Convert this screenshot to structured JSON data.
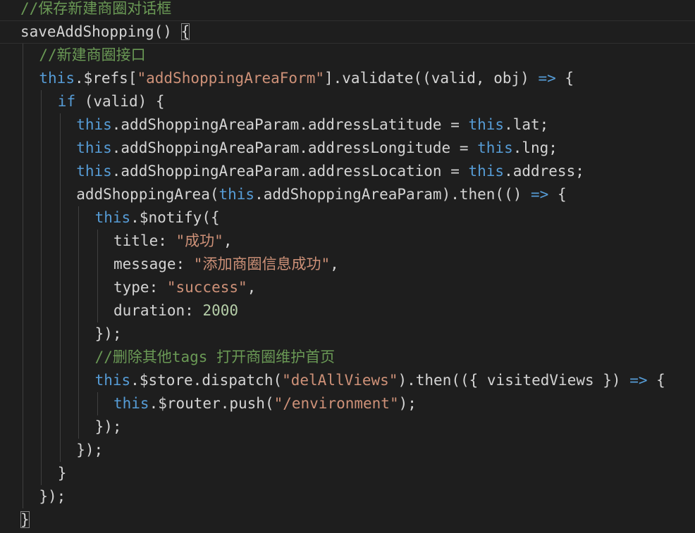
{
  "editor": {
    "lines": [
      {
        "indent": 0,
        "guides": 0,
        "tokens": [
          {
            "t": "comment",
            "v": "//保存新建商圈对话框"
          }
        ]
      },
      {
        "indent": 0,
        "guides": 0,
        "current": true,
        "tokens": [
          {
            "t": "plain",
            "v": "saveAddShopping() "
          },
          {
            "t": "plain",
            "v": "{",
            "match": true
          }
        ]
      },
      {
        "indent": 1,
        "guides": 1,
        "tokens": [
          {
            "t": "comment",
            "v": "//新建商圈接口"
          }
        ]
      },
      {
        "indent": 1,
        "guides": 1,
        "tokens": [
          {
            "t": "keyword",
            "v": "this"
          },
          {
            "t": "plain",
            "v": ".$refs["
          },
          {
            "t": "string",
            "v": "\"addShoppingAreaForm\""
          },
          {
            "t": "plain",
            "v": "].validate((valid, obj) "
          },
          {
            "t": "keyword",
            "v": "=>"
          },
          {
            "t": "plain",
            "v": " {"
          }
        ]
      },
      {
        "indent": 2,
        "guides": 2,
        "tokens": [
          {
            "t": "control",
            "v": "if"
          },
          {
            "t": "plain",
            "v": " (valid) {"
          }
        ]
      },
      {
        "indent": 3,
        "guides": 3,
        "tokens": [
          {
            "t": "keyword",
            "v": "this"
          },
          {
            "t": "plain",
            "v": ".addShoppingAreaParam.addressLatitude = "
          },
          {
            "t": "keyword",
            "v": "this"
          },
          {
            "t": "plain",
            "v": ".lat;"
          }
        ]
      },
      {
        "indent": 3,
        "guides": 3,
        "tokens": [
          {
            "t": "keyword",
            "v": "this"
          },
          {
            "t": "plain",
            "v": ".addShoppingAreaParam.addressLongitude = "
          },
          {
            "t": "keyword",
            "v": "this"
          },
          {
            "t": "plain",
            "v": ".lng;"
          }
        ]
      },
      {
        "indent": 3,
        "guides": 3,
        "tokens": [
          {
            "t": "keyword",
            "v": "this"
          },
          {
            "t": "plain",
            "v": ".addShoppingAreaParam.addressLocation = "
          },
          {
            "t": "keyword",
            "v": "this"
          },
          {
            "t": "plain",
            "v": ".address;"
          }
        ]
      },
      {
        "indent": 3,
        "guides": 3,
        "tokens": [
          {
            "t": "plain",
            "v": "addShoppingArea("
          },
          {
            "t": "keyword",
            "v": "this"
          },
          {
            "t": "plain",
            "v": ".addShoppingAreaParam).then(() "
          },
          {
            "t": "keyword",
            "v": "=>"
          },
          {
            "t": "plain",
            "v": " {"
          }
        ]
      },
      {
        "indent": 4,
        "guides": 4,
        "tokens": [
          {
            "t": "keyword",
            "v": "this"
          },
          {
            "t": "plain",
            "v": ".$notify({"
          }
        ]
      },
      {
        "indent": 5,
        "guides": 5,
        "tokens": [
          {
            "t": "plain",
            "v": "title: "
          },
          {
            "t": "string",
            "v": "\"成功\""
          },
          {
            "t": "plain",
            "v": ","
          }
        ]
      },
      {
        "indent": 5,
        "guides": 5,
        "tokens": [
          {
            "t": "plain",
            "v": "message: "
          },
          {
            "t": "string",
            "v": "\"添加商圈信息成功\""
          },
          {
            "t": "plain",
            "v": ","
          }
        ]
      },
      {
        "indent": 5,
        "guides": 5,
        "tokens": [
          {
            "t": "plain",
            "v": "type: "
          },
          {
            "t": "string",
            "v": "\"success\""
          },
          {
            "t": "plain",
            "v": ","
          }
        ]
      },
      {
        "indent": 5,
        "guides": 5,
        "tokens": [
          {
            "t": "plain",
            "v": "duration: "
          },
          {
            "t": "number",
            "v": "2000"
          }
        ]
      },
      {
        "indent": 4,
        "guides": 4,
        "tokens": [
          {
            "t": "plain",
            "v": "});"
          }
        ]
      },
      {
        "indent": 4,
        "guides": 4,
        "tokens": [
          {
            "t": "comment",
            "v": "//删除其他tags 打开商圈维护首页"
          }
        ]
      },
      {
        "indent": 4,
        "guides": 4,
        "tokens": [
          {
            "t": "keyword",
            "v": "this"
          },
          {
            "t": "plain",
            "v": ".$store.dispatch("
          },
          {
            "t": "string",
            "v": "\"delAllViews\""
          },
          {
            "t": "plain",
            "v": ").then(({ visitedViews }) "
          },
          {
            "t": "keyword",
            "v": "=>"
          },
          {
            "t": "plain",
            "v": " {"
          }
        ]
      },
      {
        "indent": 5,
        "guides": 5,
        "tokens": [
          {
            "t": "keyword",
            "v": "this"
          },
          {
            "t": "plain",
            "v": ".$router.push("
          },
          {
            "t": "string",
            "v": "\"/environment\""
          },
          {
            "t": "plain",
            "v": ");"
          }
        ]
      },
      {
        "indent": 4,
        "guides": 4,
        "tokens": [
          {
            "t": "plain",
            "v": "});"
          }
        ]
      },
      {
        "indent": 3,
        "guides": 3,
        "tokens": [
          {
            "t": "plain",
            "v": "});"
          }
        ]
      },
      {
        "indent": 2,
        "guides": 2,
        "tokens": [
          {
            "t": "plain",
            "v": "}"
          }
        ]
      },
      {
        "indent": 1,
        "guides": 1,
        "tokens": [
          {
            "t": "plain",
            "v": "});"
          }
        ]
      },
      {
        "indent": 0,
        "guides": 0,
        "tokens": [
          {
            "t": "plain",
            "v": "}",
            "match": true
          }
        ]
      }
    ],
    "colors": {
      "background": "#1e1e1e",
      "comment": "#6a9955",
      "keyword": "#569cd6",
      "string": "#ce9178",
      "number": "#b5cea8",
      "text": "#d4d4d4",
      "indent_guide": "#404040"
    }
  }
}
